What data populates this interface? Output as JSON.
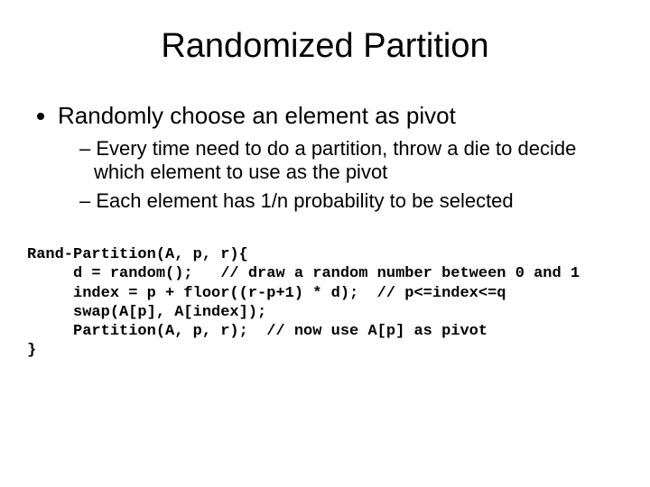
{
  "title": "Randomized Partition",
  "bullets": {
    "b1": "Randomly choose an element as pivot",
    "sub1": "Every time need to do a partition, throw a die to decide which element to use as the pivot",
    "sub2": "Each element has 1/n probability to be selected"
  },
  "code": "Rand-Partition(A, p, r){\n     d = random();   // draw a random number between 0 and 1\n     index = p + floor((r-p+1) * d);  // p<=index<=q\n     swap(A[p], A[index]);\n     Partition(A, p, r);  // now use A[p] as pivot\n}"
}
